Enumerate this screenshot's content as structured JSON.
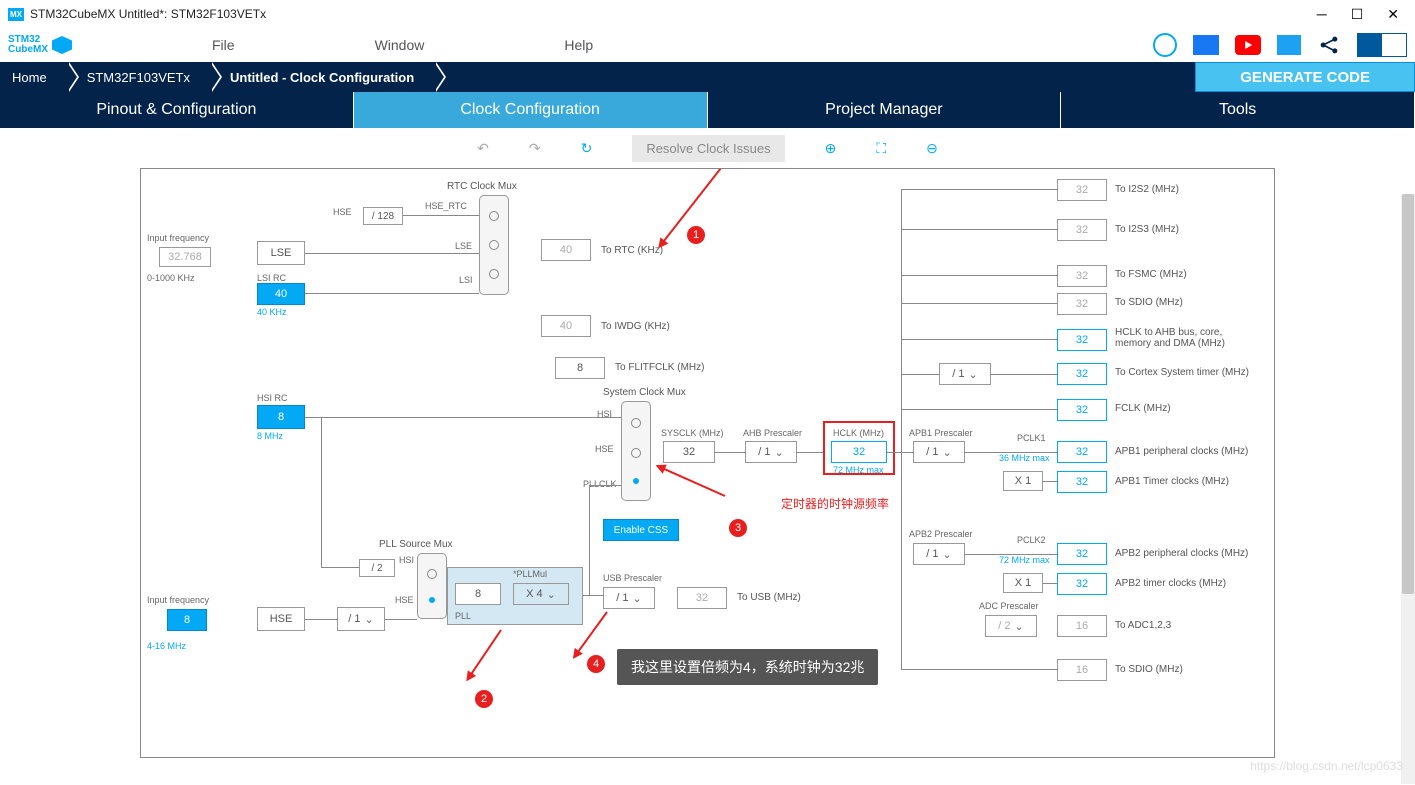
{
  "titlebar": {
    "app_badge": "MX",
    "title": "STM32CubeMX Untitled*: STM32F103VETx"
  },
  "menu": {
    "file": "File",
    "window": "Window",
    "help": "Help"
  },
  "logo": {
    "line1": "STM32",
    "line2": "CubeMX"
  },
  "crumbs": {
    "home": "Home",
    "chip": "STM32F103VETx",
    "page": "Untitled - Clock Configuration"
  },
  "generate": "GENERATE CODE",
  "tabs": {
    "pinout": "Pinout & Configuration",
    "clock": "Clock Configuration",
    "pm": "Project Manager",
    "tools": "Tools"
  },
  "toolbar": {
    "resolve": "Resolve Clock Issues"
  },
  "diagram": {
    "input_freq_lbl": "Input frequency",
    "lse_val": "32.768",
    "lse_range": "0-1000 KHz",
    "hse_in": "8",
    "hse_range": "4-16 MHz",
    "lse": "LSE",
    "lsi": "40",
    "lsi_lbl": "LSI RC",
    "lsi_note": "40 KHz",
    "hsi": "8",
    "hsi_lbl": "HSI RC",
    "hsi_note": "8 MHz",
    "hse_box": "HSE",
    "hse_div": "/ 1",
    "rtc_title": "RTC Clock Mux",
    "hse_label": "HSE",
    "hse_div128": "/ 128",
    "hse_rtc": "HSE_RTC",
    "lse_label": "LSE",
    "lsi_label": "LSI",
    "to_rtc_v": "40",
    "to_rtc": "To RTC (KHz)",
    "to_iwdg_v": "40",
    "to_iwdg": "To IWDG (KHz)",
    "flitf_v": "8",
    "flitf": "To FLITFCLK (MHz)",
    "sys_title": "System Clock Mux",
    "pll_title": "PLL Source Mux",
    "pll_div2": "/ 2",
    "pll_hsi": "HSI",
    "pll_hse": "HSE",
    "pll_n": "8",
    "pll_mul_lbl": "*PLLMul",
    "pll_mul": "X 4",
    "pll_lbl": "PLL",
    "enable_css": "Enable CSS",
    "sys_hsi": "HSI",
    "sys_hse": "HSE",
    "sys_pll": "PLLCLK",
    "sysclk_lbl": "SYSCLK (MHz)",
    "sysclk": "32",
    "ahb_lbl": "AHB Prescaler",
    "ahb": "/ 1",
    "hclk_lbl": "HCLK (MHz)",
    "hclk": "32",
    "hclk_max": "72 MHz max",
    "usb_lbl": "USB Prescaler",
    "usb_div": "/ 1",
    "usb_v": "32",
    "usb": "To USB (MHz)",
    "apb1_lbl": "APB1 Prescaler",
    "apb1": "/ 1",
    "pclk1_lbl": "PCLK1",
    "pclk1_max": "36 MHz max",
    "x1a": "X 1",
    "apb1_per": "32",
    "apb1_per_lbl": "APB1 peripheral clocks (MHz)",
    "apb1_tim": "32",
    "apb1_tim_lbl": "APB1 Timer clocks (MHz)",
    "apb2_lbl": "APB2 Prescaler",
    "apb2": "/ 1",
    "pclk2_lbl": "PCLK2",
    "pclk2_max": "72 MHz max",
    "x1b": "X 1",
    "apb2_per": "32",
    "apb2_per_lbl": "APB2 peripheral clocks (MHz)",
    "apb2_tim": "32",
    "apb2_tim_lbl": "APB2 timer clocks (MHz)",
    "adc_lbl": "ADC Prescaler",
    "adc": "/ 2",
    "adc_v": "16",
    "adc_out": "To ADC1,2,3",
    "sdio2": "16",
    "sdio2_lbl": "To SDIO (MHz)",
    "i2s2": "32",
    "i2s2_lbl": "To I2S2 (MHz)",
    "i2s3": "32",
    "i2s3_lbl": "To I2S3 (MHz)",
    "fsmc": "32",
    "fsmc_lbl": "To FSMC (MHz)",
    "sdio": "32",
    "sdio_lbl": "To SDIO (MHz)",
    "ahb_bus": "32",
    "ahb_bus_lbl": "HCLK to AHB bus, core, memory and DMA (MHz)",
    "cortex_div": "/ 1",
    "cortex": "32",
    "cortex_lbl": "To Cortex System timer (MHz)",
    "fclk": "32",
    "fclk_lbl": "FCLK (MHz)"
  },
  "anno": {
    "red_text": "定时器的时钟源频率",
    "tooltip": "我这里设置倍频为4，系统时钟为32兆",
    "n1": "1",
    "n2": "2",
    "n3": "3",
    "n4": "4"
  },
  "watermark": "https://blog.csdn.net/lcp0633"
}
